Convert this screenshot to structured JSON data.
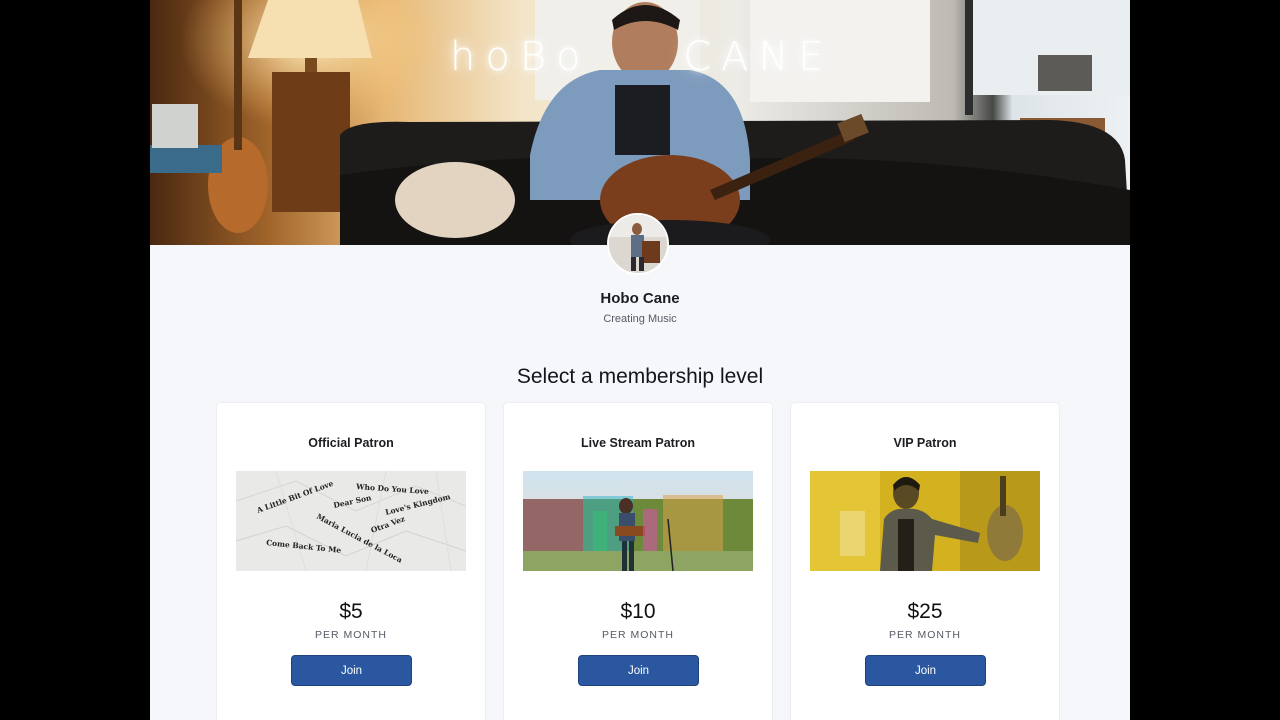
{
  "banner": {
    "title": "hoBo CANE"
  },
  "creator": {
    "name": "Hobo Cane",
    "subtitle": "Creating Music"
  },
  "section_heading": "Select a membership level",
  "tiers": [
    {
      "name": "Official Patron",
      "price": "$5",
      "period": "PER MONTH",
      "button": "Join",
      "image_words": [
        "A Little Bit Of Love",
        "Dear Son",
        "Who Do You Love",
        "Love's Kingdom",
        "Maria Lucia de la Loca",
        "Otra Vez",
        "Come Back To Me"
      ]
    },
    {
      "name": "Live Stream Patron",
      "price": "$10",
      "period": "PER MONTH",
      "button": "Join"
    },
    {
      "name": "VIP Patron",
      "price": "$25",
      "period": "PER MONTH",
      "button": "Join"
    }
  ],
  "colors": {
    "accent": "#2a57a0",
    "page_background": "#f6f7fb",
    "outer_background": "#000000"
  }
}
